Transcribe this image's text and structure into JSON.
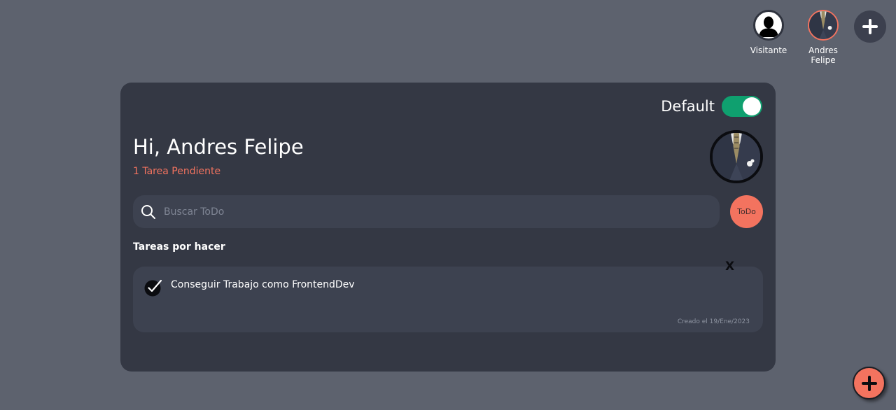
{
  "users": [
    {
      "name": "Visitante",
      "avatar_icon": "person-silhouette-icon"
    },
    {
      "name": "Andres Felipe",
      "avatar_icon": "suit-portrait-icon"
    }
  ],
  "add_user_icon": "plus-icon",
  "theme_toggle": {
    "label": "Default",
    "on": true,
    "on_color": "#0fa06f"
  },
  "greeting": "Hi, Andres Felipe",
  "pending_text": "1 Tarea Pendiente",
  "search": {
    "placeholder": "Buscar ToDo",
    "value": ""
  },
  "todo_button_label": "ToDo",
  "section_title": "Tareas por hacer",
  "tasks": [
    {
      "text": "Conseguir Trabajo como FrontendDev",
      "date": "Creado el 19/Ene/2023",
      "completed": true,
      "delete_label": "X"
    }
  ],
  "colors": {
    "background": "#5d626e",
    "card": "#343844",
    "accent": "#f3735f"
  }
}
